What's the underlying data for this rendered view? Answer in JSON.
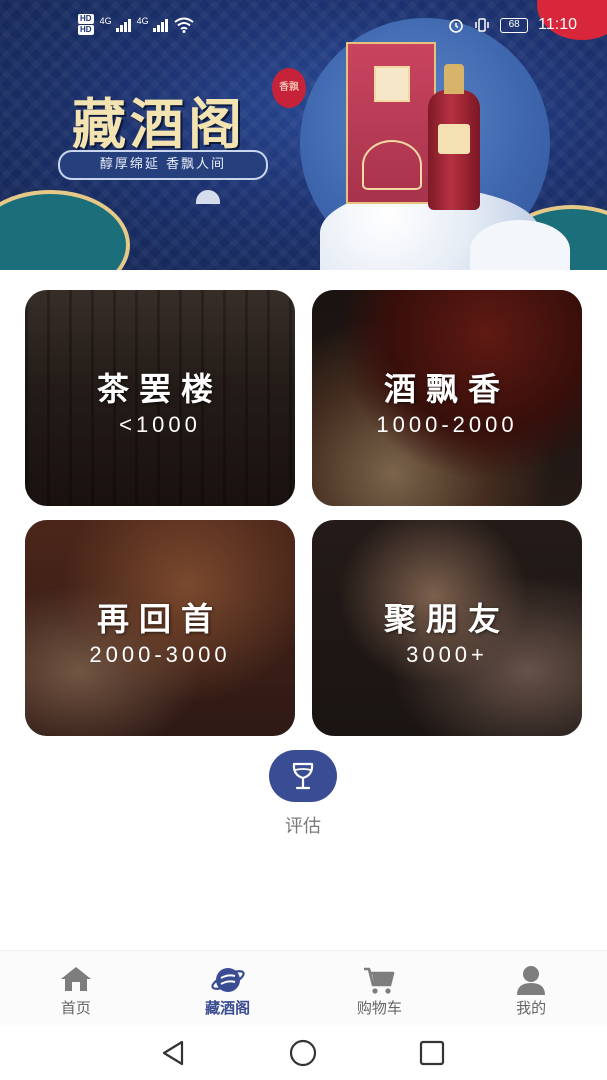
{
  "status_bar": {
    "hd1": "HD",
    "hd2": "HD",
    "net1": "4G",
    "net2": "4G",
    "battery": "68",
    "time": "11:10"
  },
  "banner": {
    "title": "藏酒阁",
    "seal": "香飘",
    "slogan": "醇厚绵延 香飘人间"
  },
  "categories": [
    {
      "name": "茶罢楼",
      "range": "<1000"
    },
    {
      "name": "酒飘香",
      "range": "1000-2000"
    },
    {
      "name": "再回首",
      "range": "2000-3000"
    },
    {
      "name": "聚朋友",
      "range": "3000+"
    }
  ],
  "evaluate": {
    "label": "评估",
    "icon": "wine-glass-icon"
  },
  "tabs": [
    {
      "label": "首页",
      "icon": "home-icon",
      "active": false
    },
    {
      "label": "藏酒阁",
      "icon": "planet-icon",
      "active": true
    },
    {
      "label": "购物车",
      "icon": "cart-icon",
      "active": false
    },
    {
      "label": "我的",
      "icon": "user-icon",
      "active": false
    }
  ],
  "colors": {
    "accent": "#3a4c93",
    "inactive_tab": "#666666",
    "eval_label": "#7a7a7a"
  }
}
